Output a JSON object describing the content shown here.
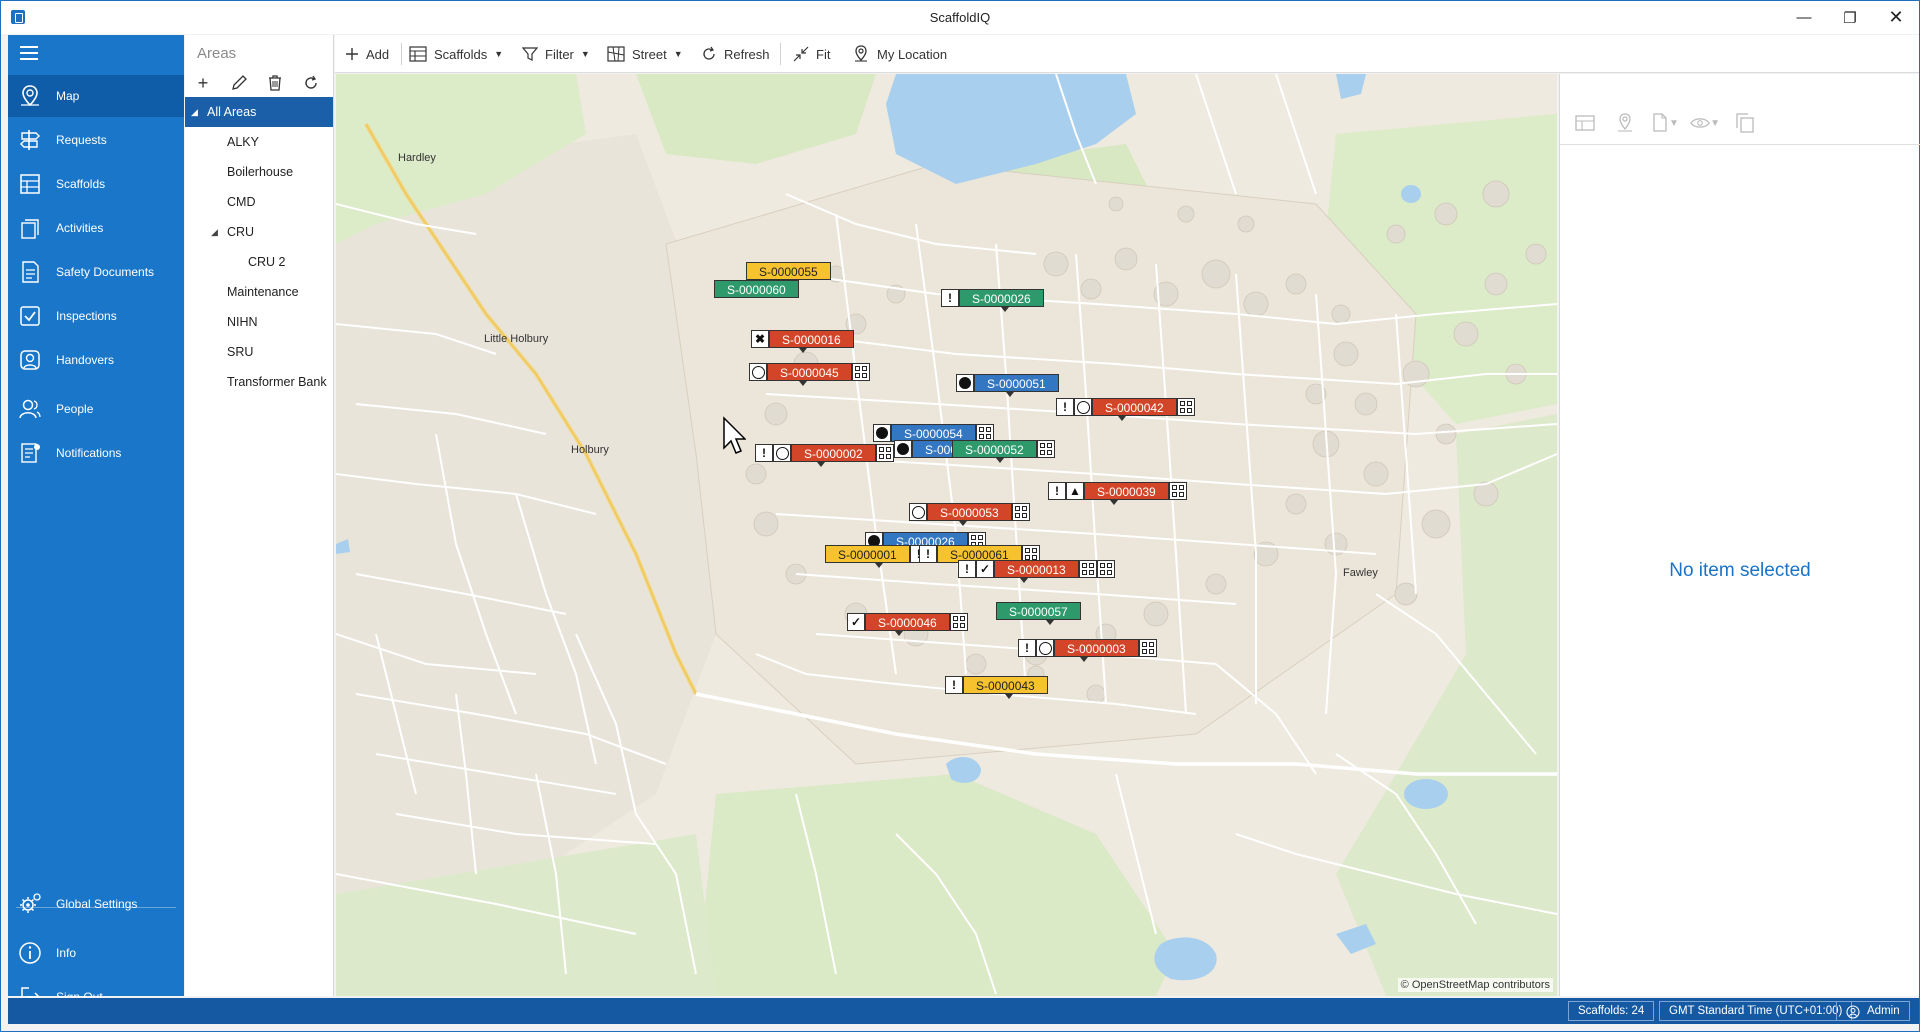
{
  "app": {
    "title": "ScaffoldIQ",
    "window_controls": [
      "minimize",
      "restore",
      "close"
    ]
  },
  "sidebar": {
    "items": [
      {
        "label": "Map",
        "icon": "map-pin-icon",
        "active": true
      },
      {
        "label": "Requests",
        "icon": "signpost-icon"
      },
      {
        "label": "Scaffolds",
        "icon": "scaffold-icon"
      },
      {
        "label": "Activities",
        "icon": "activities-icon"
      },
      {
        "label": "Safety Documents",
        "icon": "document-icon"
      },
      {
        "label": "Inspections",
        "icon": "checkbox-icon"
      },
      {
        "label": "Handovers",
        "icon": "handover-icon"
      },
      {
        "label": "People",
        "icon": "people-icon"
      },
      {
        "label": "Notifications",
        "icon": "notifications-icon"
      }
    ],
    "bottom": [
      {
        "label": "Global Settings",
        "icon": "gear-icon"
      },
      {
        "label": "Info",
        "icon": "info-icon"
      },
      {
        "label": "Sign Out",
        "icon": "sign-out-icon"
      }
    ]
  },
  "areas": {
    "title": "Areas",
    "tools": [
      "add-icon",
      "edit-icon",
      "delete-icon",
      "refresh-icon"
    ],
    "tree": [
      {
        "label": "All Areas",
        "level": 0,
        "expanded": true,
        "selected": true
      },
      {
        "label": "ALKY",
        "level": 1
      },
      {
        "label": "Boilerhouse",
        "level": 1
      },
      {
        "label": "CMD",
        "level": 1
      },
      {
        "label": "CRU",
        "level": 1,
        "expanded": true
      },
      {
        "label": "CRU 2",
        "level": 2
      },
      {
        "label": "Maintenance",
        "level": 1
      },
      {
        "label": "NIHN",
        "level": 1
      },
      {
        "label": "SRU",
        "level": 1
      },
      {
        "label": "Transformer Bank",
        "level": 1
      }
    ]
  },
  "toolbar": {
    "add": "Add",
    "scaffolds": "Scaffolds",
    "filter": "Filter",
    "street": "Street",
    "refresh": "Refresh",
    "fit": "Fit",
    "my_location": "My Location"
  },
  "map": {
    "credit": "© OpenStreetMap contributors",
    "places": [
      "Hardley",
      "Little Holbury",
      "Holbury",
      "Fawley"
    ],
    "colors": {
      "red": "#d34528",
      "green": "#2e9a6c",
      "blue": "#3376c2",
      "yellow": "#f6c32f",
      "water": "#a8cfee"
    },
    "markers": [
      {
        "id": "S-0000055",
        "color": "yellow"
      },
      {
        "id": "S-0000060",
        "color": "green"
      },
      {
        "id": "S-0000026",
        "color": "green",
        "icons": [
          "warning"
        ]
      },
      {
        "id": "S-0000016",
        "color": "red",
        "icons": [
          "tools"
        ]
      },
      {
        "id": "S-0000045",
        "color": "red",
        "icons": [
          "cycle"
        ],
        "qr": true
      },
      {
        "id": "S-0000051",
        "color": "blue",
        "icons": [
          "up"
        ]
      },
      {
        "id": "S-0000042",
        "color": "red",
        "icons": [
          "warning",
          "down"
        ],
        "qr": true
      },
      {
        "id": "S-0000054",
        "color": "blue",
        "icons": [
          "up"
        ],
        "qr": true
      },
      {
        "id": "S-0000",
        "color": "blue",
        "icons": [
          "up"
        ]
      },
      {
        "id": "S-0000052",
        "color": "green",
        "qr": true
      },
      {
        "id": "S-0000002",
        "color": "red",
        "icons": [
          "warning",
          "down"
        ],
        "qr": true
      },
      {
        "id": "S-0000039",
        "color": "red",
        "icons": [
          "warning",
          "hazard"
        ],
        "qr": true
      },
      {
        "id": "S-0000053",
        "color": "red",
        "icons": [
          "cycle"
        ],
        "qr": true
      },
      {
        "id": "S-0000026",
        "color": "blue",
        "icons": [
          "up"
        ],
        "qr": true
      },
      {
        "id": "S-0000001",
        "color": "yellow",
        "icons": [
          "warning"
        ]
      },
      {
        "id": "S-0000061",
        "color": "yellow",
        "icons": [
          "warning"
        ],
        "qr": true
      },
      {
        "id": "S-0000013",
        "color": "red",
        "icons": [
          "warning",
          "check"
        ],
        "qr": true
      },
      {
        "id": "S-0000057",
        "color": "green"
      },
      {
        "id": "S-0000046",
        "color": "red",
        "icons": [
          "check"
        ],
        "qr": true
      },
      {
        "id": "S-0000003",
        "color": "red",
        "icons": [
          "warning",
          "down"
        ],
        "qr": true
      },
      {
        "id": "S-0000043",
        "color": "yellow",
        "icons": [
          "warning"
        ]
      }
    ]
  },
  "detail": {
    "tools": [
      "table-icon",
      "location-icon",
      "document-icon",
      "eye-icon",
      "copy-icon"
    ],
    "empty": "No item selected"
  },
  "status": {
    "scaffolds": "Scaffolds: 24",
    "timezone": "GMT Standard Time (UTC+01:00)",
    "user": "Admin"
  }
}
